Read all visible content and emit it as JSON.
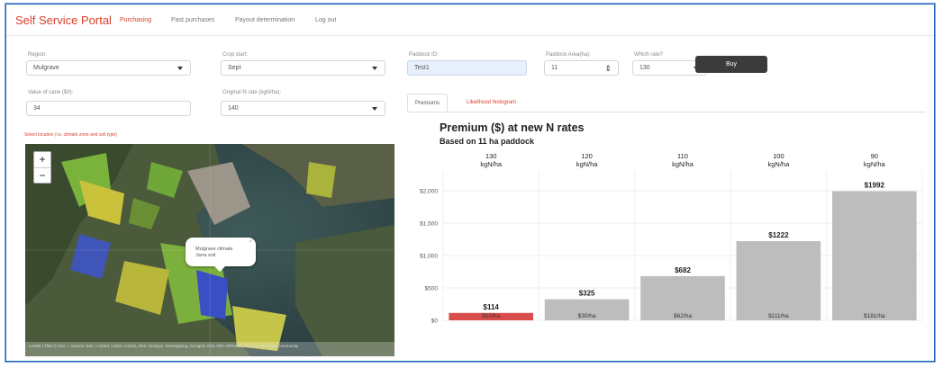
{
  "nav": {
    "brand": "Self Service Portal",
    "items": [
      "Purchasing",
      "Past purchases",
      "Payout determination",
      "Log out"
    ]
  },
  "form": {
    "region": {
      "label": "Region:",
      "value": "Mulgrave"
    },
    "crop_start": {
      "label": "Crop start:",
      "value": "Sept"
    },
    "cane_value": {
      "label": "Value of cane ($/t):",
      "value": "34"
    },
    "original_n": {
      "label": "Original N rate (kgN/ha):",
      "value": "140"
    },
    "paddock_id": {
      "label": "Paddock ID:",
      "value": "Test1"
    },
    "paddock_area": {
      "label": "Paddock Area(ha):",
      "value": "11"
    },
    "which_rate": {
      "label": "Which rate?",
      "value": "130"
    },
    "buy_label": "Buy"
  },
  "map": {
    "hint": "Select location (i.e. climate zone and soil type)",
    "popup_line1": "Mulgrave climate",
    "popup_line2": "Jarra soil",
    "zoom_in": "+",
    "zoom_out": "−",
    "attribution": "Leaflet | Tiles © Esri — Source: Esri, i-cubed, USDA, USGS, AEX, GeoEye, Getmapping, Aerogrid, IGN, IGP, UPR-EGP, and the GIS User Community"
  },
  "tabs": [
    "Premiums",
    "Likelihood histogram"
  ],
  "colors": {
    "accent": "#d9412c",
    "bar_gray": "#bdbdbd",
    "bar_highlight": "#d94c4c",
    "nav_border": "#1f5fbf"
  },
  "chart_data": {
    "type": "bar",
    "title": "Premium ($) at new N rates",
    "subtitle": "Based on 11 ha paddock",
    "categories": [
      "130\nkgN/ha",
      "120\nkgN/ha",
      "110\nkgN/ha",
      "100\nkgN/ha",
      "90\nkgN/ha"
    ],
    "values": [
      114,
      325,
      682,
      1222,
      1992
    ],
    "value_labels": [
      "$114",
      "$325",
      "$682",
      "$1222",
      "$1992"
    ],
    "per_ha_labels": [
      "$10/ha",
      "$30/ha",
      "$62/ha",
      "$111/ha",
      "$181/ha"
    ],
    "highlight_index": 0,
    "yticks": [
      "$0",
      "$500",
      "$1,000",
      "$1,500",
      "$2,000"
    ],
    "ytick_values": [
      0,
      500,
      1000,
      1500,
      2000
    ],
    "ylim": [
      0,
      2200
    ]
  }
}
